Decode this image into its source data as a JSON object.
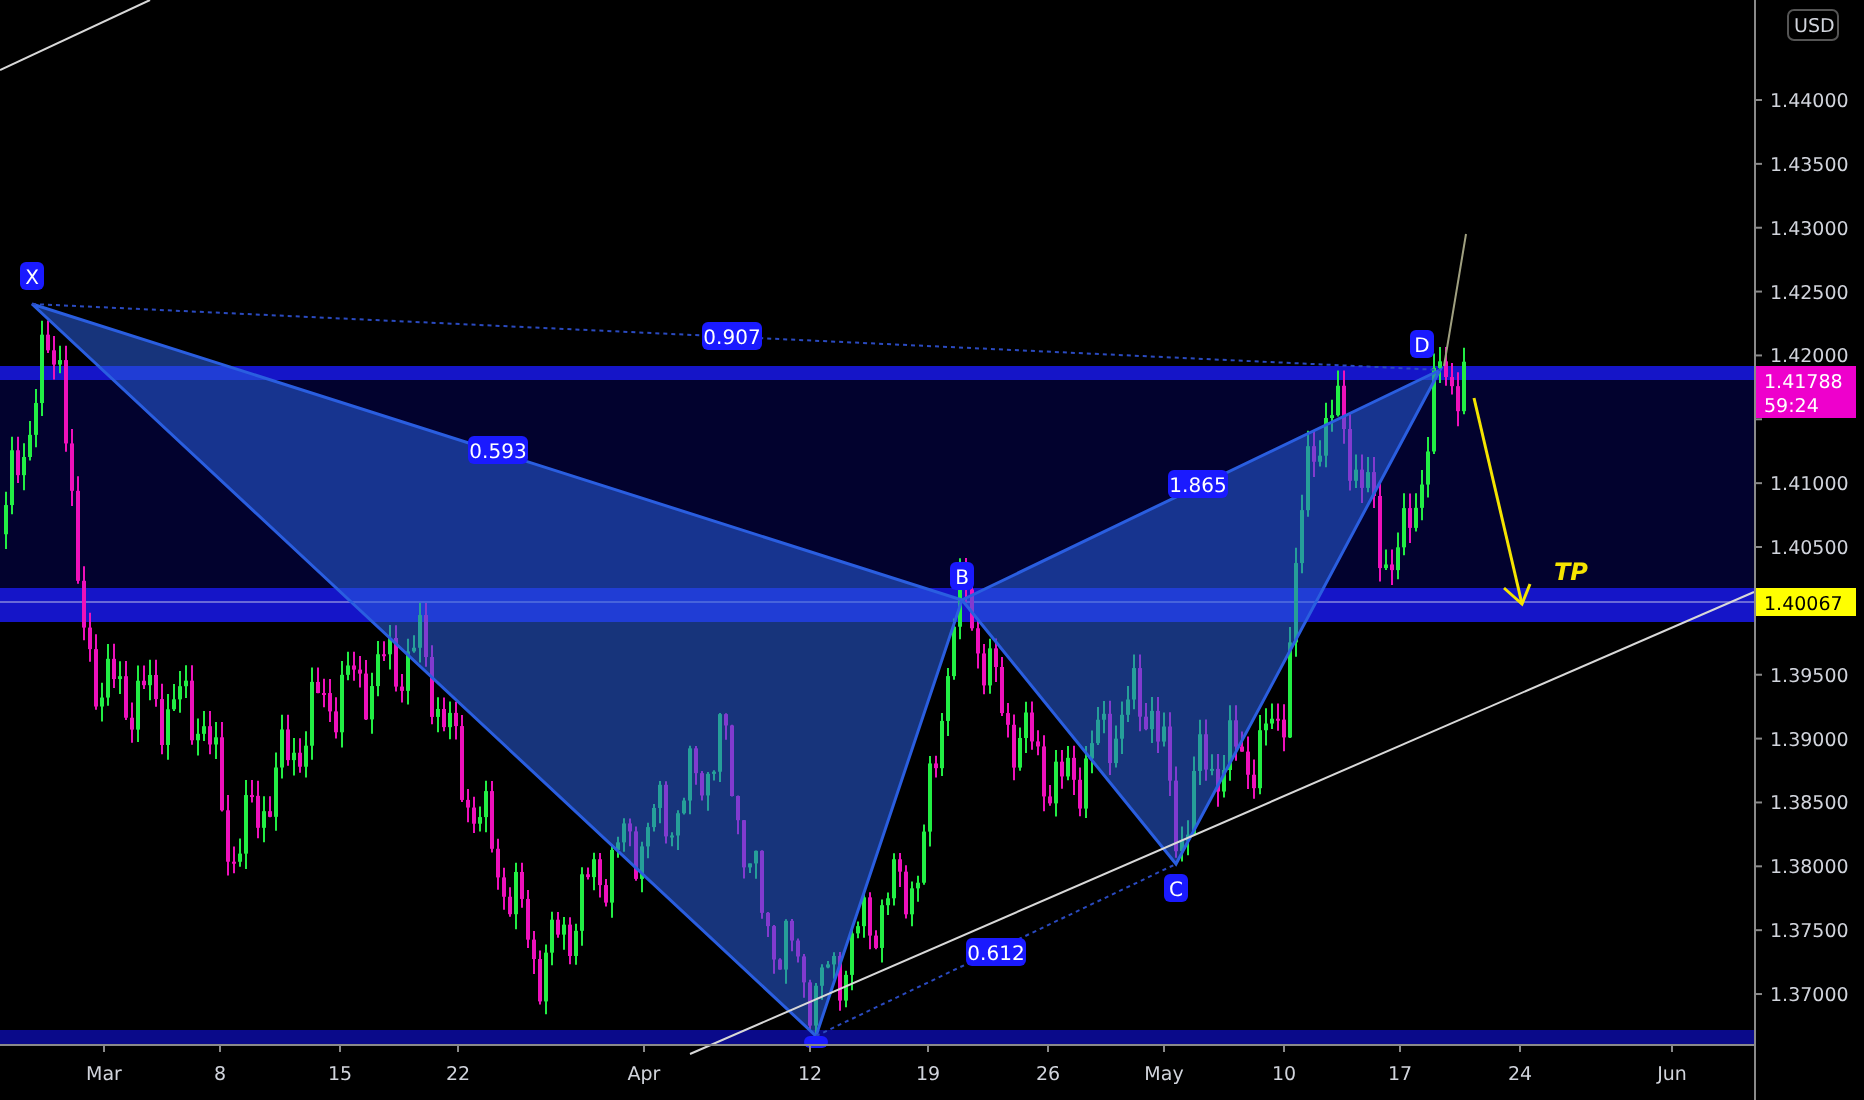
{
  "price_axis": {
    "currency": "USD",
    "ticks": [
      "1.44000",
      "1.43500",
      "1.43000",
      "1.42500",
      "1.42000",
      "1.41000",
      "1.40500",
      "1.39500",
      "1.39000",
      "1.38500",
      "1.38000",
      "1.37500",
      "1.37000"
    ],
    "last_price": "1.41788",
    "countdown": "59:24",
    "target_price": "1.40067"
  },
  "time_axis": {
    "ticks": [
      "Mar",
      "8",
      "15",
      "22",
      "Apr",
      "12",
      "19",
      "26",
      "May",
      "10",
      "17",
      "24",
      "Jun"
    ]
  },
  "pattern": {
    "points": [
      {
        "label": "X"
      },
      {
        "label": "B"
      },
      {
        "label": "C"
      },
      {
        "label": "D"
      }
    ],
    "ratios": [
      "0.907",
      "0.593",
      "1.865",
      "0.612"
    ]
  },
  "annotations": {
    "target_label": "TP"
  }
}
